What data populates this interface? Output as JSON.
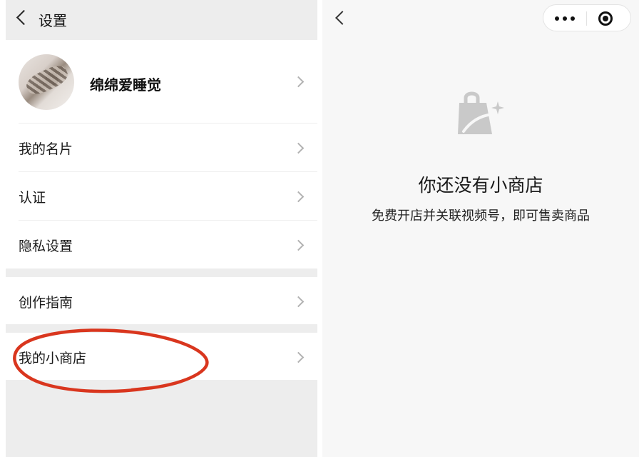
{
  "settings": {
    "header_title": "设置",
    "profile": {
      "name": "绵绵爱睡觉"
    },
    "items": [
      {
        "label": "我的名片"
      },
      {
        "label": "认证"
      },
      {
        "label": "隐私设置"
      },
      {
        "label": "创作指南"
      },
      {
        "label": "我的小商店"
      }
    ],
    "annotation_color": "#d9361e"
  },
  "shop": {
    "empty_title": "你还没有小商店",
    "empty_subtitle": "免费开店并关联视频号，即可售卖商品",
    "icon": "shopping-bag-sparkle-icon",
    "icon_color": "#c9c9c9"
  }
}
